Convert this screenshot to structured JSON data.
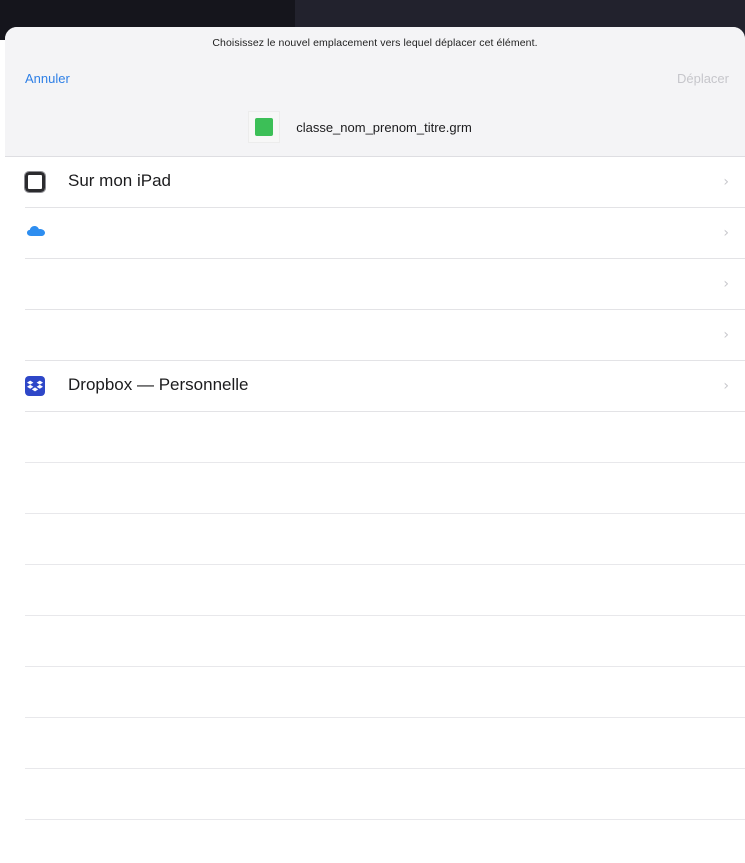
{
  "header": {
    "prompt": "Choisissez le nouvel emplacement vers lequel déplacer cet élément.",
    "cancel_label": "Annuler",
    "move_label": "Déplacer",
    "file_name": "classe_nom_prenom_titre.grm"
  },
  "locations": [
    {
      "label": "Sur mon iPad",
      "icon": "ipad-icon"
    },
    {
      "label": "",
      "icon": "icloud-icon"
    },
    {
      "label": "",
      "icon": ""
    },
    {
      "label": "",
      "icon": ""
    },
    {
      "label": "Dropbox — Personnelle",
      "icon": "dropbox-icon"
    }
  ],
  "chevron": "›",
  "colors": {
    "accent": "#2f80e6",
    "disabled": "#c6c6cb",
    "dropbox": "#2e47c8",
    "file_icon": "#3cbf57"
  }
}
